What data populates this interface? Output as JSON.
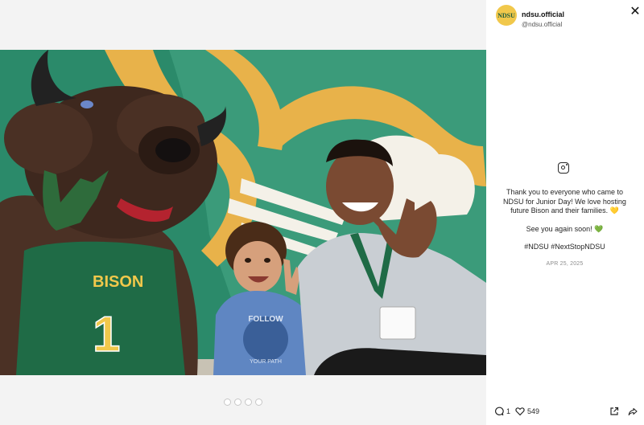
{
  "post": {
    "username": "ndsu.official",
    "handle": "@ndsu.official",
    "avatar_text": "NDSU",
    "caption_lines": [
      "Thank you to everyone who came to NDSU for Junior Day! We love hosting future Bison and their families. 💛",
      "See you again soon! 💚",
      "#NDSU #NextStopNDSU"
    ],
    "date": "APR 25, 2025",
    "comments_count": "1",
    "likes_count": "549"
  },
  "photo": {
    "jersey_text": "BISON",
    "jersey_number": "1",
    "shirt_text_top": "FOLLOW",
    "shirt_text_bottom": "YOUR PATH"
  },
  "carousel": {
    "count": 4,
    "active": 0
  },
  "icons": {
    "close": "close-icon",
    "instagram": "instagram-icon",
    "comment": "comment-icon",
    "like": "heart-icon",
    "open": "open-external-icon",
    "share": "share-icon"
  },
  "colors": {
    "ndsu_green": "#1d6e46",
    "ndsu_yellow": "#f1c84b",
    "panel_bg": "#f3f3f3"
  }
}
